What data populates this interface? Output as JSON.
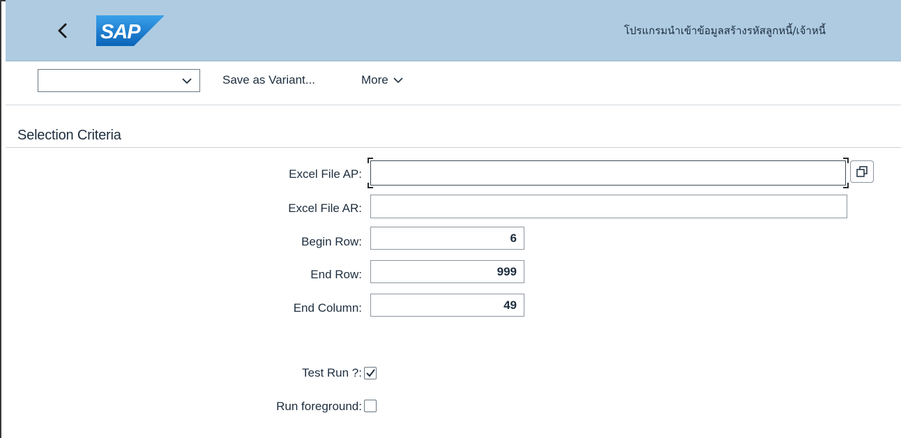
{
  "shellbar": {
    "title": "โปรแกรมนำเข้าข้อมูลสร้างรหัสลูกหนี้/เจ้าหนี้",
    "logo_text": "SAP",
    "back_icon": "chevron-left-icon"
  },
  "toolbar": {
    "variant_value": "",
    "save_variant_label": "Save as Variant...",
    "more_label": "More"
  },
  "selection": {
    "section_title": "Selection Criteria",
    "excel_file_ap_label": "Excel File AP:",
    "excel_file_ap_value": "",
    "excel_file_ar_label": "Excel File AR:",
    "excel_file_ar_value": "",
    "begin_row_label": "Begin Row:",
    "begin_row_value": "6",
    "end_row_label": "End Row:",
    "end_row_value": "999",
    "end_column_label": "End Column:",
    "end_column_value": "49",
    "test_run_label": "Test Run ?:",
    "test_run_checked": true,
    "run_foreground_label": "Run foreground:",
    "run_foreground_checked": false
  },
  "colors": {
    "shellbar_bg": "#aecbe1",
    "sap_logo_blue": "#1d7fd0"
  }
}
